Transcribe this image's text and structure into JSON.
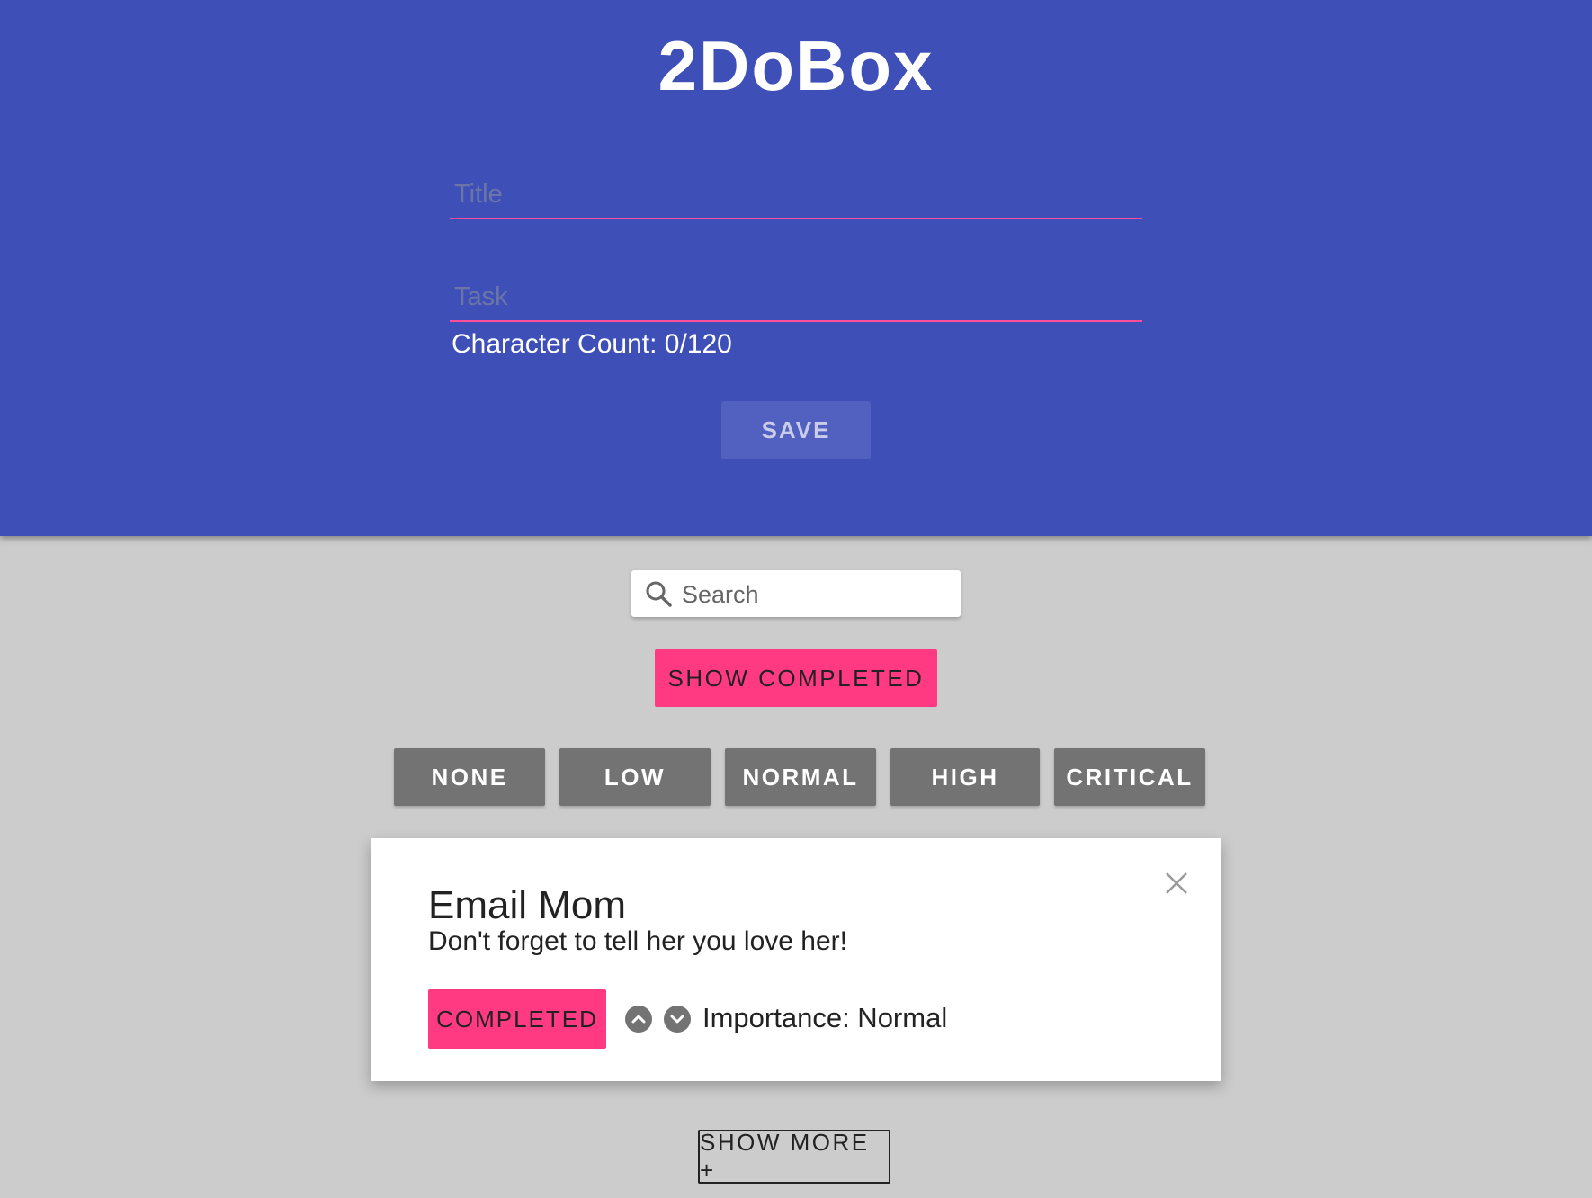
{
  "header": {
    "app_title": "2DoBox",
    "title_placeholder": "Title",
    "task_placeholder": "Task",
    "char_count": "Character Count: 0/120",
    "save_label": "SAVE"
  },
  "controls": {
    "search_placeholder": "Search",
    "show_completed_label": "SHOW COMPLETED",
    "filters": [
      "NONE",
      "LOW",
      "NORMAL",
      "HIGH",
      "CRITICAL"
    ]
  },
  "todos": [
    {
      "title": "Email Mom",
      "body": "Don't forget to tell her you love her!",
      "completed_label": "COMPLETED",
      "importance": "Importance: Normal"
    }
  ],
  "footer": {
    "show_more_label": "SHOW MORE +"
  },
  "colors": {
    "header_bg": "#3e50b8",
    "page_bg": "#cccccc",
    "accent_pink": "#ff3a83",
    "filter_gray": "#737373"
  },
  "icons": [
    "search-icon",
    "close-icon",
    "upvote-icon",
    "downvote-icon"
  ]
}
